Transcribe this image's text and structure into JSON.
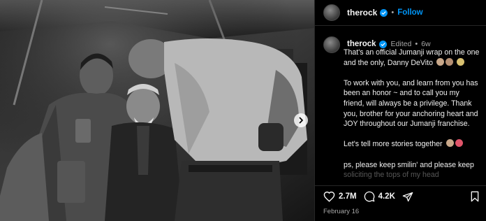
{
  "post": {
    "username": "therock",
    "follow_label": "Follow",
    "dot": "•",
    "edited_label": "Edited",
    "edited_dot": "•",
    "time_ago": "6w",
    "caption_paragraphs": [
      "That's an official Jumanji wrap on the one and the only, Danny DeVito",
      "To work with you, and learn from you has been an honor ~ and to call you my friend, will always be a privilege. Thank you, brother for your anchoring heart and JOY throughout our Jumanji franchise.",
      "Let's tell more stories together",
      "ps, please keep smilin' and please keep"
    ],
    "caption_cutoff": "soliciting the tops of my head",
    "likes": "2.7M",
    "comments": "4.2K",
    "date": "February 16"
  },
  "colors": {
    "accent": "#0095f6",
    "verified": "#0095f6",
    "muted": "#a8a8a8"
  },
  "icons": [
    "verified-icon",
    "heart-icon",
    "comment-icon",
    "share-icon",
    "bookmark-icon",
    "chevron-right-icon"
  ]
}
